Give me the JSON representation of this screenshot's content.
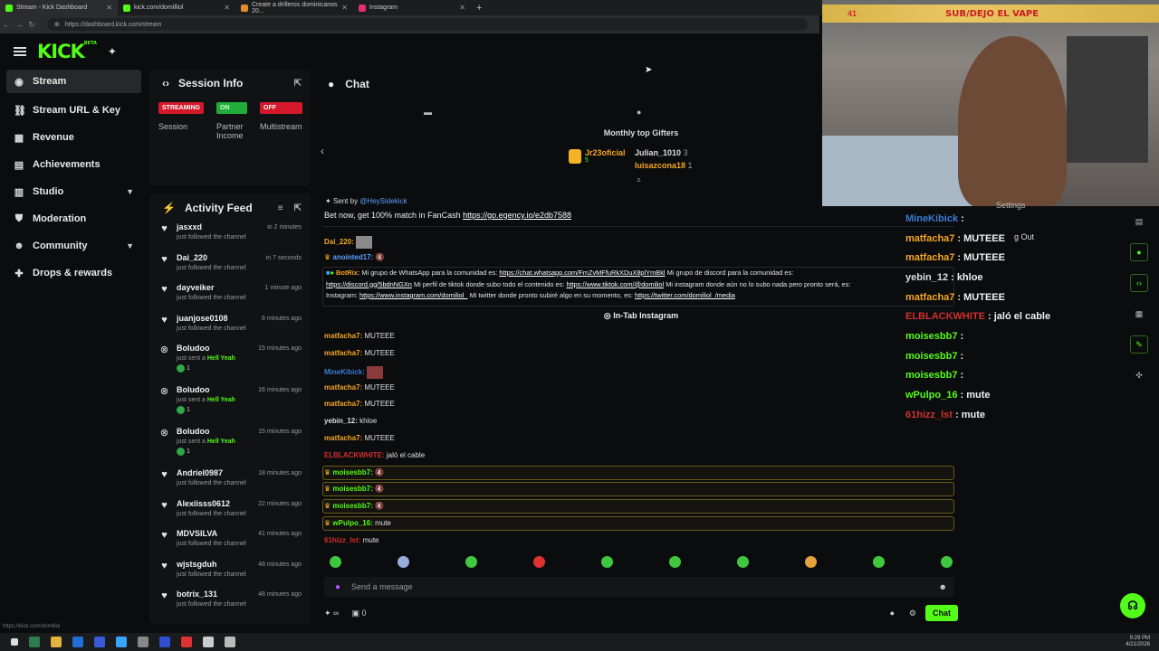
{
  "browser": {
    "tabs": [
      {
        "label": "Stream - Kick Dashboard",
        "color": "#53fc18"
      },
      {
        "label": "kick.com/domilliol",
        "color": "#53fc18"
      },
      {
        "label": "Create a drilleros dominicanos 20...",
        "color": "#e08a2f"
      },
      {
        "label": "Instagram",
        "color": "#e1306c"
      }
    ],
    "url": "https://dashboard.kick.com/stream"
  },
  "logo": {
    "text": "KICK",
    "tag": "BETA"
  },
  "sidebar": {
    "items": [
      {
        "label": "Stream",
        "icon": "broadcast-icon"
      },
      {
        "label": "Stream URL & Key",
        "icon": "link-icon"
      },
      {
        "label": "Revenue",
        "icon": "bank-icon"
      },
      {
        "label": "Achievements",
        "icon": "grid-icon"
      },
      {
        "label": "Studio",
        "icon": "book-icon"
      },
      {
        "label": "Moderation",
        "icon": "shield-icon"
      },
      {
        "label": "Community",
        "icon": "people-icon"
      },
      {
        "label": "Drops & rewards",
        "icon": "gift-icon"
      }
    ]
  },
  "session": {
    "title": "Session Info",
    "items": [
      {
        "badge": "STREAMING",
        "label": "Session",
        "color": "#d3182a"
      },
      {
        "badge": "ON",
        "label": "Partner Income",
        "color": "#20ad3a"
      },
      {
        "badge": "OFF",
        "label": "Multistream",
        "color": "#d3182a"
      }
    ]
  },
  "activity": {
    "title": "Activity Feed",
    "rows": [
      {
        "name": "jasxxd",
        "time": "in 2 minutes",
        "desc": "just followed the channel",
        "type": "follow"
      },
      {
        "name": "Dai_220",
        "time": "in 7 seconds",
        "desc": "just followed the channel",
        "type": "follow"
      },
      {
        "name": "dayveiker",
        "time": "1 minute ago",
        "desc": "just followed the channel",
        "type": "follow"
      },
      {
        "name": "juanjose0108",
        "time": "6 minutes ago",
        "desc": "just followed the channel",
        "type": "follow"
      },
      {
        "name": "Boludoo",
        "time": "15 minutes ago",
        "desc": "just sent a",
        "hl": "Hell Yeah",
        "count": "1",
        "type": "gift"
      },
      {
        "name": "Boludoo",
        "time": "16 minutes ago",
        "desc": "just sent a",
        "hl": "Hell Yeah",
        "count": "1",
        "type": "gift"
      },
      {
        "name": "Boludoo",
        "time": "15 minutes ago",
        "desc": "just sent a",
        "hl": "Hell Yeah",
        "count": "1",
        "type": "gift"
      },
      {
        "name": "Andriel0987",
        "time": "18 minutes ago",
        "desc": "just followed the channel",
        "type": "follow"
      },
      {
        "name": "Alexiisss0612",
        "time": "22 minutes ago",
        "desc": "just followed the channel",
        "type": "follow"
      },
      {
        "name": "MDVSILVA",
        "time": "41 minutes ago",
        "desc": "just followed the channel",
        "type": "follow"
      },
      {
        "name": "wjstsgduh",
        "time": "48 minutes ago",
        "desc": "just followed the channel",
        "type": "follow"
      },
      {
        "name": "botrix_131",
        "time": "48 minutes ago",
        "desc": "just followed the channel",
        "type": "follow"
      }
    ]
  },
  "chat": {
    "title": "Chat",
    "gifters_title": "Monthly top Gifters",
    "gifters": [
      {
        "name": "Jr23oficial",
        "count": "5"
      },
      {
        "name": "Julian_1010",
        "count": "3"
      },
      {
        "name": "luisazcona18",
        "count": "1"
      }
    ],
    "pinned_by": "Sent by",
    "pinned_user": "@HeySidekick",
    "pinned_text": "Bet now, get 100% match in FanCash",
    "pinned_link": "https://go.egency.io/e2db7588",
    "early_user": "Dai_220:",
    "early2_user": "anointed17:",
    "botrix_user": "BotRix:",
    "botrix_l1": "Mi grupo de WhatsApp para la comunidad es:",
    "botrix_l1_link": "https://chat.whatsapp.com/FmZvMFfuRkXDuX8plYmBkl",
    "botrix_l1b": "Mi grupo de discord para la comunidad es:",
    "botrix_l2_link": "https://discord.gg/5bdnNGXn",
    "botrix_l2": "Mi perfil de tiktok donde subo todo el contenido es:",
    "botrix_l2_link2": "https://www.tiktok.com/@domiliol",
    "botrix_l2b": "Mi instagram donde aún no lo subo nada pero pronto será, es:",
    "botrix_l3a": "Instagram:",
    "botrix_l3_link": "https://www.instagram.com/domiliol_",
    "botrix_l3b": "Mi twitter donde pronto subiré algo en su momento, es:",
    "botrix_l3_link2": "https://twitter.com/domiliol_/media",
    "intab": "In-Tab Instagram",
    "messages": [
      {
        "user": "matfacha7:",
        "text": "MUTEEE",
        "cls": "u-orange"
      },
      {
        "user": "matfacha7:",
        "text": "MUTEEE",
        "cls": "u-orange"
      },
      {
        "user": "MineKibick:",
        "text": "",
        "cls": "u-blue"
      },
      {
        "user": "matfacha7:",
        "text": "MUTEEE",
        "cls": "u-orange"
      },
      {
        "user": "matfacha7:",
        "text": "MUTEEE",
        "cls": "u-orange"
      },
      {
        "user": "yebin_12:",
        "text": "khloe",
        "cls": "u-white"
      },
      {
        "user": "matfacha7:",
        "text": "MUTEEE",
        "cls": "u-orange"
      },
      {
        "user": "ELBLACKWHITE:",
        "text": "jaló el cable",
        "cls": "u-red"
      },
      {
        "user": "moisesbb7:",
        "text": "",
        "cls": "u-green"
      },
      {
        "user": "moisesbb7:",
        "text": "",
        "cls": "u-green"
      },
      {
        "user": "moisesbb7:",
        "text": "",
        "cls": "u-green"
      },
      {
        "user": "wPulpo_16:",
        "text": "mute",
        "cls": "u-green"
      },
      {
        "user": "61hizz_lst:",
        "text": "mute",
        "cls": "u-red"
      }
    ],
    "input_placeholder": "Send a message",
    "viewers": "∞",
    "points": "0",
    "send_label": "Chat"
  },
  "webcam": {
    "count": "41",
    "title": "SUB/DEJO EL VAPE"
  },
  "overlay_chat": [
    {
      "user": "MineKibick",
      "text": ":",
      "color": "#3a7bd5"
    },
    {
      "user": "matfacha7",
      "text": ": MUTEEE",
      "color": "#f5a623"
    },
    {
      "user": "matfacha7",
      "text": ": MUTEEE",
      "color": "#f5a623"
    },
    {
      "user": "yebin_12",
      "text": ": khloe",
      "color": "#dddddd"
    },
    {
      "user": "matfacha7",
      "text": ": MUTEEE",
      "color": "#f5a623"
    },
    {
      "user": "ELBLACKWHITE",
      "text": ": jaló el cable",
      "color": "#d32f2f"
    },
    {
      "user": "moisesbb7",
      "text": ":",
      "color": "#53fc18"
    },
    {
      "user": "moisesbb7",
      "text": ":",
      "color": "#53fc18"
    },
    {
      "user": "moisesbb7",
      "text": ":",
      "color": "#53fc18"
    },
    {
      "user": "wPulpo_16",
      "text": ": mute",
      "color": "#53fc18"
    },
    {
      "user": "61hizz_lst",
      "text": ": mute",
      "color": "#d32f2f"
    }
  ],
  "overlay_fragment": "Settings",
  "overlay_fragment2": "g Out",
  "taskbar": {
    "time": "9:29 PM",
    "date": "4/21/2026"
  },
  "status_url": "https://kick.com/domiliol"
}
